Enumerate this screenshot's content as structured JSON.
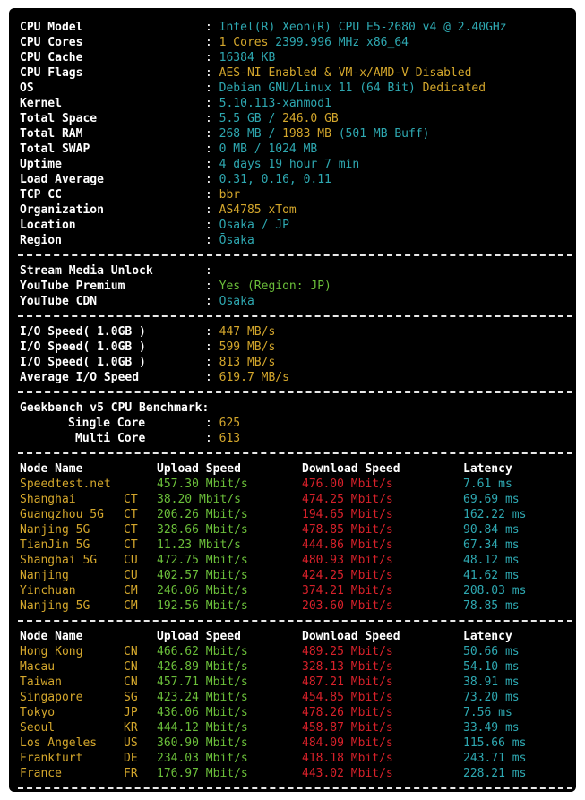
{
  "sysinfo": [
    {
      "label": "CPU Model",
      "parts": [
        {
          "t": "Intel(R) Xeon(R) CPU E5-2680 v4 @ 2.40GHz",
          "c": "cy"
        }
      ]
    },
    {
      "label": "CPU Cores",
      "parts": [
        {
          "t": "1 Cores ",
          "c": "ye"
        },
        {
          "t": "2399.996 MHz x86_64",
          "c": "cy"
        }
      ]
    },
    {
      "label": "CPU Cache",
      "parts": [
        {
          "t": "16384 KB",
          "c": "cy"
        }
      ]
    },
    {
      "label": "CPU Flags",
      "parts": [
        {
          "t": "AES-NI Enabled & VM-x/AMD-V Disabled",
          "c": "ye"
        }
      ]
    },
    {
      "label": "OS",
      "parts": [
        {
          "t": "Debian GNU/Linux 11 (64 Bit) ",
          "c": "cy"
        },
        {
          "t": "Dedicated",
          "c": "ye"
        }
      ]
    },
    {
      "label": "Kernel",
      "parts": [
        {
          "t": "5.10.113-xanmod1",
          "c": "cy"
        }
      ]
    },
    {
      "label": "Total Space",
      "parts": [
        {
          "t": "5.5 GB / ",
          "c": "cy"
        },
        {
          "t": "246.0 GB",
          "c": "ye"
        }
      ]
    },
    {
      "label": "Total RAM",
      "parts": [
        {
          "t": "268 MB / ",
          "c": "cy"
        },
        {
          "t": "1983 MB",
          "c": "ye"
        },
        {
          "t": " (501 MB Buff)",
          "c": "cy"
        }
      ]
    },
    {
      "label": "Total SWAP",
      "parts": [
        {
          "t": "0 MB / 1024 MB",
          "c": "cy"
        }
      ]
    },
    {
      "label": "Uptime",
      "parts": [
        {
          "t": "4 days 19 hour 7 min",
          "c": "cy"
        }
      ]
    },
    {
      "label": "Load Average",
      "parts": [
        {
          "t": "0.31, 0.16, 0.11",
          "c": "cy"
        }
      ]
    },
    {
      "label": "TCP CC",
      "parts": [
        {
          "t": "bbr",
          "c": "ye"
        }
      ]
    },
    {
      "label": "Organization",
      "parts": [
        {
          "t": "AS4785 xTom",
          "c": "ye"
        }
      ]
    },
    {
      "label": "Location",
      "parts": [
        {
          "t": "Osaka / JP",
          "c": "cy"
        }
      ]
    },
    {
      "label": "Region",
      "parts": [
        {
          "t": "Ōsaka",
          "c": "cy"
        }
      ]
    }
  ],
  "stream": {
    "title": "Stream Media Unlock",
    "rows": [
      {
        "label": "YouTube Premium",
        "value": "Yes (Region: JP)",
        "c": "gr"
      },
      {
        "label": "YouTube CDN",
        "value": "Osaka",
        "c": "cy"
      }
    ]
  },
  "io": [
    {
      "label": "I/O Speed( 1.0GB )",
      "value": "447 MB/s"
    },
    {
      "label": "I/O Speed( 1.0GB )",
      "value": "599 MB/s"
    },
    {
      "label": "I/O Speed( 1.0GB )",
      "value": "813 MB/s"
    },
    {
      "label": "Average I/O Speed",
      "value": "619.7 MB/s"
    }
  ],
  "geekbench": {
    "title": "Geekbench v5 CPU Benchmark:",
    "rows": [
      {
        "label": "Single Core",
        "value": "625"
      },
      {
        "label": "Multi Core",
        "value": "613"
      }
    ]
  },
  "colon": ":",
  "headers": {
    "node": "Node Name",
    "upload": "Upload Speed",
    "download": "Download Speed",
    "latency": "Latency"
  },
  "speed1": [
    {
      "node": "Speedtest.net",
      "isp": "",
      "up": "457.30 Mbit/s",
      "down": "476.00 Mbit/s",
      "lat": "7.61 ms"
    },
    {
      "node": "Shanghai",
      "isp": "CT",
      "up": "38.20 Mbit/s",
      "down": "474.25 Mbit/s",
      "lat": "69.69 ms"
    },
    {
      "node": "Guangzhou 5G",
      "isp": "CT",
      "up": "206.26 Mbit/s",
      "down": "194.65 Mbit/s",
      "lat": "162.22 ms"
    },
    {
      "node": "Nanjing 5G",
      "isp": "CT",
      "up": "328.66 Mbit/s",
      "down": "478.85 Mbit/s",
      "lat": "90.84 ms"
    },
    {
      "node": "TianJin 5G",
      "isp": "CT",
      "up": "11.23 Mbit/s",
      "down": "444.86 Mbit/s",
      "lat": "67.34 ms"
    },
    {
      "node": "Shanghai 5G",
      "isp": "CU",
      "up": "472.75 Mbit/s",
      "down": "480.93 Mbit/s",
      "lat": "48.12 ms"
    },
    {
      "node": "Nanjing",
      "isp": "CU",
      "up": "402.57 Mbit/s",
      "down": "424.25 Mbit/s",
      "lat": "41.62 ms"
    },
    {
      "node": "Yinchuan",
      "isp": "CM",
      "up": "246.06 Mbit/s",
      "down": "374.21 Mbit/s",
      "lat": "208.03 ms"
    },
    {
      "node": "Nanjing 5G",
      "isp": "CM",
      "up": "192.56 Mbit/s",
      "down": "203.60 Mbit/s",
      "lat": "78.85 ms"
    }
  ],
  "speed2": [
    {
      "node": "Hong Kong",
      "isp": "CN",
      "up": "466.62 Mbit/s",
      "down": "489.25 Mbit/s",
      "lat": "50.66 ms"
    },
    {
      "node": "Macau",
      "isp": "CN",
      "up": "426.89 Mbit/s",
      "down": "328.13 Mbit/s",
      "lat": "54.10 ms"
    },
    {
      "node": "Taiwan",
      "isp": "CN",
      "up": "457.71 Mbit/s",
      "down": "487.21 Mbit/s",
      "lat": "38.91 ms"
    },
    {
      "node": "Singapore",
      "isp": "SG",
      "up": "423.24 Mbit/s",
      "down": "454.85 Mbit/s",
      "lat": "73.20 ms"
    },
    {
      "node": "Tokyo",
      "isp": "JP",
      "up": "436.06 Mbit/s",
      "down": "478.26 Mbit/s",
      "lat": "7.56 ms"
    },
    {
      "node": "Seoul",
      "isp": "KR",
      "up": "444.12 Mbit/s",
      "down": "458.87 Mbit/s",
      "lat": "33.49 ms"
    },
    {
      "node": "Los Angeles",
      "isp": "US",
      "up": "360.90 Mbit/s",
      "down": "484.09 Mbit/s",
      "lat": "115.66 ms"
    },
    {
      "node": "Frankfurt",
      "isp": "DE",
      "up": "234.03 Mbit/s",
      "down": "418.18 Mbit/s",
      "lat": "243.71 ms"
    },
    {
      "node": "France",
      "isp": "FR",
      "up": "176.97 Mbit/s",
      "down": "443.02 Mbit/s",
      "lat": "228.21 ms"
    }
  ]
}
